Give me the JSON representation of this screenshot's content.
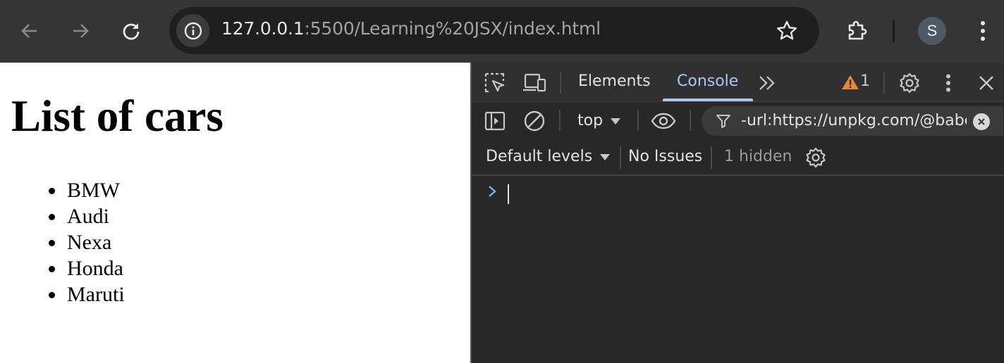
{
  "browser": {
    "address": {
      "host": "127.0.0.1",
      "path": ":5500/Learning%20JSX/index.html"
    },
    "profile_initial": "S",
    "icons": [
      "back-icon",
      "forward-icon",
      "reload-icon",
      "info-icon",
      "star-icon",
      "extensions-icon",
      "more-vert-icon"
    ]
  },
  "page": {
    "heading": "List of cars",
    "cars": [
      "BMW",
      "Audi",
      "Nexa",
      "Honda",
      "Maruti"
    ]
  },
  "devtools": {
    "tabs": {
      "elements": "Elements",
      "console": "Console"
    },
    "active_tab": "Console",
    "warning_count": "1",
    "context": "top",
    "filter_value": "-url:https://unpkg.com/@babel",
    "levels": "Default levels",
    "issues": "No Issues",
    "hidden": "1 hidden"
  },
  "colors": {
    "toolbar": "#353535",
    "devtools_bg": "#282828",
    "accent": "#a8c7fa",
    "warning": "#e8863a"
  }
}
